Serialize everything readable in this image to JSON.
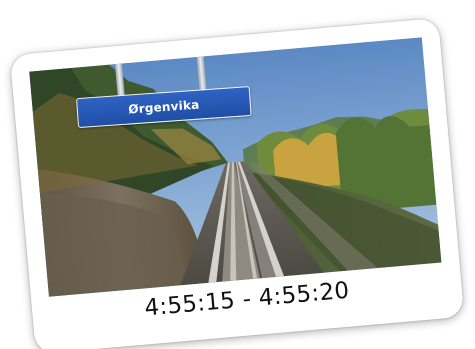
{
  "station_sign": {
    "name": "Ørgenvika"
  },
  "caption": {
    "timestamp_range": "4:55:15 - 4:55:20"
  },
  "colors": {
    "sign_blue": "#2356b8",
    "sky": "#6f9ccf",
    "card_background": "#ffffff"
  }
}
